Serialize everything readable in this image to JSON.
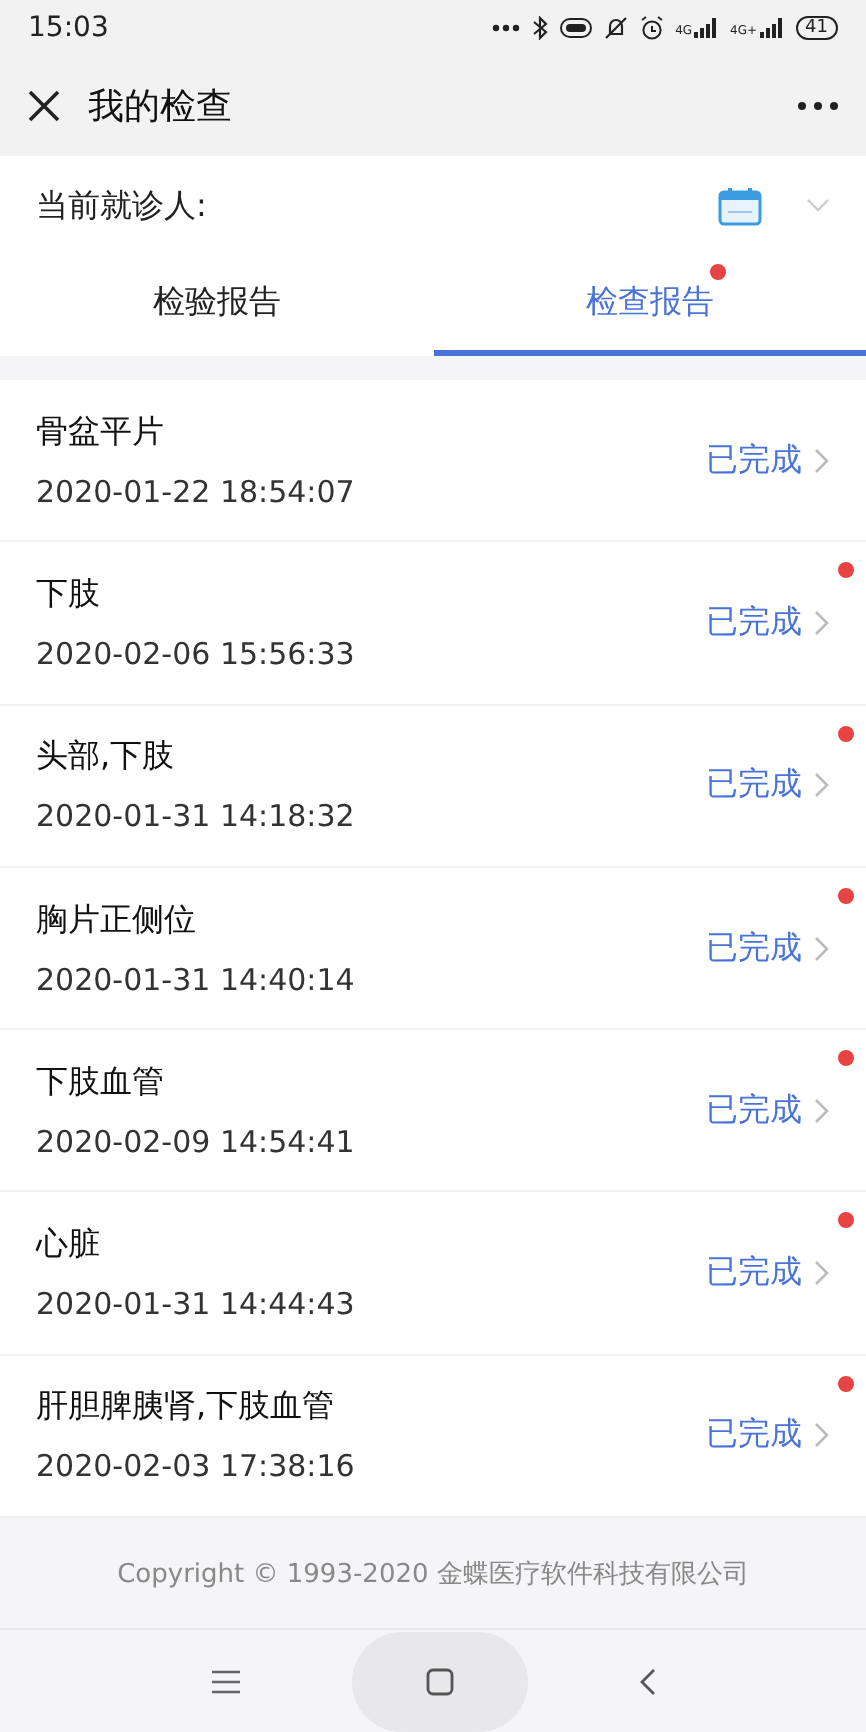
{
  "status_bar": {
    "time": "15:03",
    "network": [
      {
        "label": "4G"
      },
      {
        "label": "4G+"
      }
    ],
    "battery": "41"
  },
  "header": {
    "title": "我的检查"
  },
  "patient": {
    "label": "当前就诊人:"
  },
  "tabs": [
    {
      "label": "检验报告",
      "selected": false,
      "dot": false
    },
    {
      "label": "检查报告",
      "selected": true,
      "dot": true
    }
  ],
  "reports": [
    {
      "name": "骨盆平片",
      "time": "2020-01-22 18:54:07",
      "status": "已完成",
      "unread": false
    },
    {
      "name": "下肢",
      "time": "2020-02-06 15:56:33",
      "status": "已完成",
      "unread": true
    },
    {
      "name": "头部,下肢",
      "time": "2020-01-31 14:18:32",
      "status": "已完成",
      "unread": true
    },
    {
      "name": "胸片正侧位",
      "time": "2020-01-31 14:40:14",
      "status": "已完成",
      "unread": true
    },
    {
      "name": "下肢血管",
      "time": "2020-02-09 14:54:41",
      "status": "已完成",
      "unread": true
    },
    {
      "name": "心脏",
      "time": "2020-01-31 14:44:43",
      "status": "已完成",
      "unread": true
    },
    {
      "name": "肝胆脾胰肾,下肢血管",
      "time": "2020-02-03 17:38:16",
      "status": "已完成",
      "unread": true
    }
  ],
  "footer": {
    "copyright": "Copyright © 1993-2020 金蝶医疗软件科技有限公司"
  }
}
